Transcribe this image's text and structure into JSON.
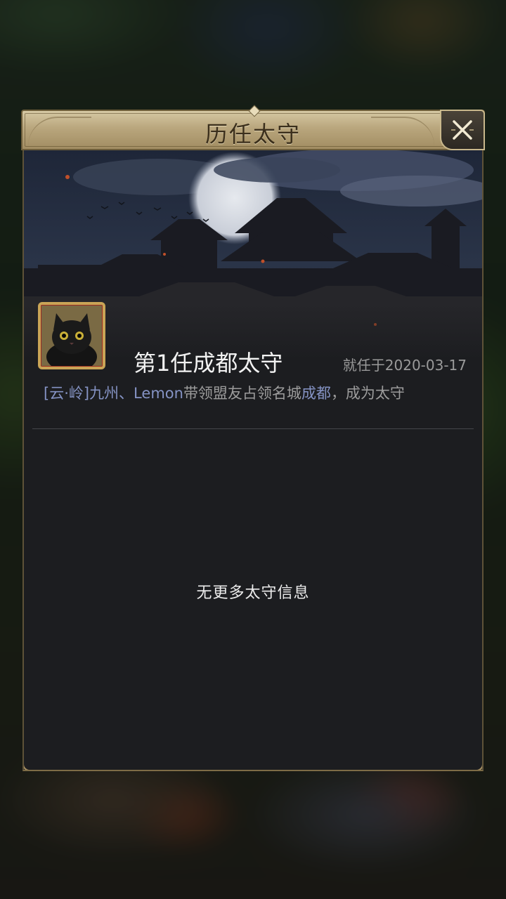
{
  "dialog": {
    "title": "历任太守",
    "close_icon": "close-x-icon"
  },
  "governor": {
    "avatar_icon": "black-cat-avatar",
    "title": "第1任成都太守",
    "appointed": "就任于2020-03-17",
    "description": {
      "alliance_tag": "[云·岭]",
      "leaders": "九州、Lemon",
      "text_before_city": "带领盟友占领名城",
      "city": "成都",
      "text_after_city": "，成为太守"
    }
  },
  "empty_message": "无更多太守信息",
  "colors": {
    "title_bar": "#b9a67d",
    "panel_background": "#1c1d20",
    "link_text": "#8593c4",
    "muted_text": "#9c9c9c"
  }
}
